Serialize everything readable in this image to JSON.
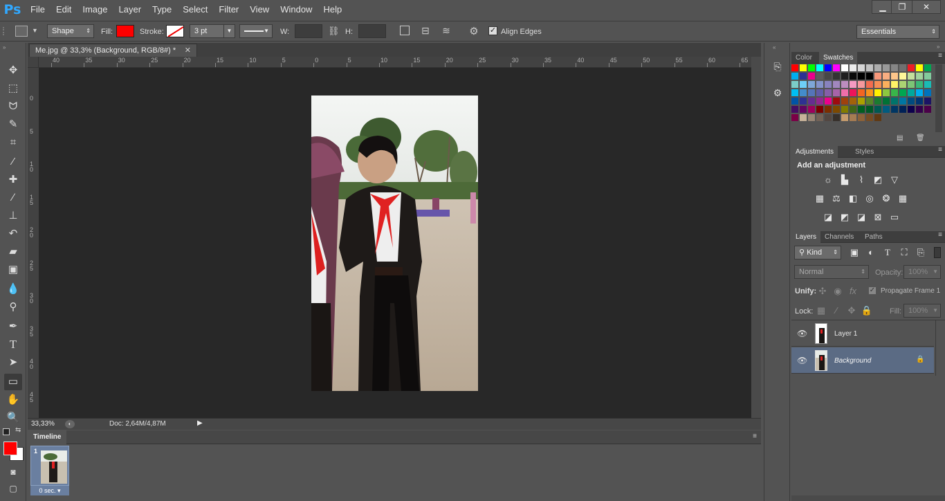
{
  "app": {
    "logo": "Ps"
  },
  "menu": [
    "File",
    "Edit",
    "Image",
    "Layer",
    "Type",
    "Select",
    "Filter",
    "View",
    "Window",
    "Help"
  ],
  "window_controls": {
    "minimize": "▁",
    "restore": "❐",
    "close": "✕"
  },
  "options_bar": {
    "mode": "Shape",
    "fill_label": "Fill:",
    "fill_color": "#ff0000",
    "stroke_label": "Stroke:",
    "stroke_width": "3 pt",
    "w_label": "W:",
    "h_label": "H:",
    "align_edges_label": "Align Edges",
    "align_edges_checked": true,
    "workspace": "Essentials"
  },
  "document": {
    "tab_title": "Me.jpg @ 33,3% (Background, RGB/8#) *",
    "zoom": "33,33%",
    "doc_info": "Doc: 2,64M/4,87M"
  },
  "ruler_top_ticks": [
    "40",
    "35",
    "30",
    "25",
    "20",
    "15",
    "10",
    "5",
    "0",
    "5",
    "10",
    "15",
    "20",
    "25",
    "30",
    "35",
    "40",
    "45",
    "50",
    "55",
    "60",
    "65"
  ],
  "ruler_left_ticks": [
    "0",
    "5",
    "1 0",
    "1 5",
    "2 0",
    "2 5",
    "3 0",
    "3 5",
    "4 0",
    "4 5"
  ],
  "timeline": {
    "label": "Timeline",
    "frame_number": "1",
    "frame_delay": "0 sec."
  },
  "swatches_panel": {
    "tabs": [
      "Color",
      "Swatches"
    ],
    "active": "Swatches",
    "colors": [
      "#ff0000",
      "#ffff00",
      "#00ff00",
      "#00ffff",
      "#0000ff",
      "#ff00ff",
      "#ffffff",
      "#ebebeb",
      "#d6d6d6",
      "#c2c2c2",
      "#adadad",
      "#999999",
      "#858585",
      "#707070",
      "#ee1c24",
      "#ffff00",
      "#00a651",
      "#00aeef",
      "#2e3192",
      "#ec008c",
      "#5c5c5c",
      "#474747",
      "#333333",
      "#1f1f1f",
      "#0a0a0a",
      "#000000",
      "#000000",
      "#f7977a",
      "#f9ad81",
      "#fdc68a",
      "#fff799",
      "#c4df9b",
      "#a2d39c",
      "#82ca9d",
      "#7bcdc8",
      "#6ecff6",
      "#7ea7d8",
      "#8493ca",
      "#8882be",
      "#a187be",
      "#bc8dbf",
      "#f49ac2",
      "#f6989d",
      "#f26c4f",
      "#f68e55",
      "#fbaf5d",
      "#fff467",
      "#acd373",
      "#7cc576",
      "#3bb878",
      "#1abbb4",
      "#00bff3",
      "#438ccb",
      "#5574b9",
      "#605ca8",
      "#855fa8",
      "#a763a8",
      "#f06eaa",
      "#ed145b",
      "#f26522",
      "#f7941d",
      "#fff200",
      "#8dc73f",
      "#39b54a",
      "#00a651",
      "#00a99d",
      "#00aeef",
      "#0072bc",
      "#0054a6",
      "#2e3192",
      "#662d91",
      "#92278f",
      "#ec008c",
      "#9e0b0f",
      "#a0410d",
      "#a3620a",
      "#aba000",
      "#598527",
      "#1a7b30",
      "#007236",
      "#00746b",
      "#0076a3",
      "#004b80",
      "#003471",
      "#1b1464",
      "#440e62",
      "#630460",
      "#9e005d",
      "#790000",
      "#7b2e00",
      "#7d4900",
      "#827b00",
      "#406618",
      "#005e20",
      "#005826",
      "#005952",
      "#005b7f",
      "#003663",
      "#002157",
      "#0d004c",
      "#32004b",
      "#4b0049",
      "#7b0046",
      "#c7b299",
      "#998675",
      "#736357",
      "#534741",
      "#37302a",
      "#c69c6d",
      "#a67c52",
      "#8c6239",
      "#754c24",
      "#603913"
    ]
  },
  "adjustments_panel": {
    "tabs": [
      "Adjustments",
      "Styles"
    ],
    "active": "Adjustments",
    "heading": "Add an adjustment",
    "icons": [
      [
        "brightness-icon",
        "levels-icon",
        "curves-icon",
        "exposure-icon",
        "vibrance-icon"
      ],
      [
        "hue-saturation-icon",
        "color-balance-icon",
        "black-white-icon",
        "photo-filter-icon",
        "channel-mixer-icon",
        "color-lookup-icon"
      ],
      [
        "invert-icon",
        "posterize-icon",
        "threshold-icon",
        "selective-color-icon",
        "gradient-map-icon"
      ]
    ]
  },
  "layers_panel": {
    "tabs": [
      "Layers",
      "Channels",
      "Paths"
    ],
    "active": "Layers",
    "filter_kind": "Kind",
    "blend_mode": "Normal",
    "opacity_label": "Opacity:",
    "opacity": "100%",
    "unify_label": "Unify:",
    "propagate_label": "Propagate Frame 1",
    "lock_label": "Lock:",
    "fill_label": "Fill:",
    "fill": "100%",
    "layers": [
      {
        "name": "Layer 1",
        "visible": true,
        "selected": false,
        "locked": false
      },
      {
        "name": "Background",
        "visible": true,
        "selected": true,
        "locked": true
      }
    ]
  }
}
